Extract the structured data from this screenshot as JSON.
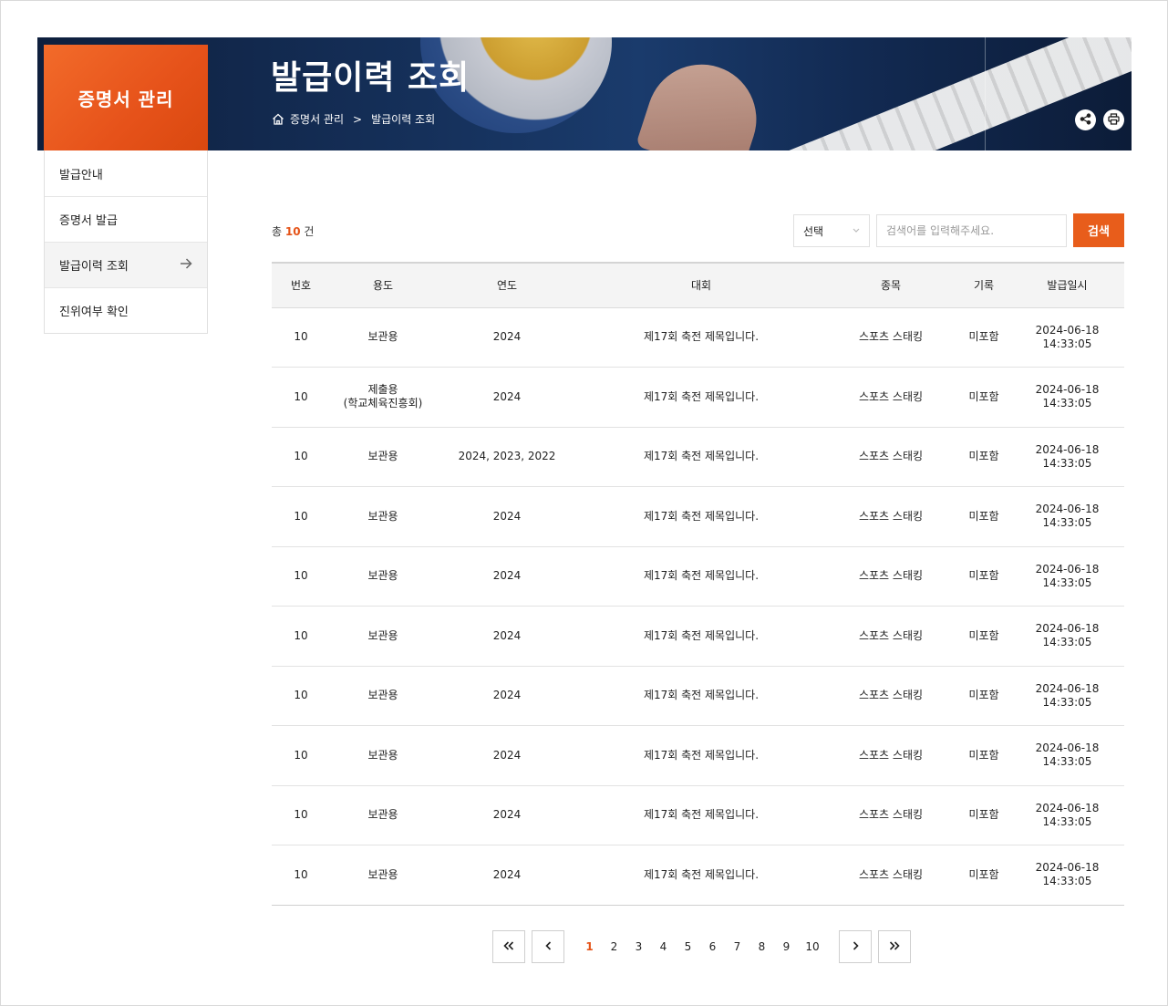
{
  "section": {
    "title": "증명서 관리"
  },
  "header": {
    "title": "발급이력 조회",
    "breadcrumb": [
      "증명서 관리",
      "발급이력 조회"
    ],
    "breadcrumb_sep": ">"
  },
  "sidebar": {
    "items": [
      {
        "label": "발급안내",
        "active": false
      },
      {
        "label": "증명서 발급",
        "active": false
      },
      {
        "label": "발급이력 조회",
        "active": true
      },
      {
        "label": "진위여부 확인",
        "active": false
      }
    ]
  },
  "toolbar": {
    "total_prefix": "총",
    "total_count": "10",
    "total_suffix": "건",
    "select_value": "선택",
    "search_placeholder": "검색어를 입력해주세요.",
    "search_label": "검색"
  },
  "table": {
    "columns": [
      "번호",
      "용도",
      "연도",
      "대회",
      "종목",
      "기록",
      "발급일시"
    ],
    "rows": [
      {
        "no": "10",
        "usage": "보관용",
        "usage2": "",
        "year": "2024",
        "event": "제17회 축전 제목입니다.",
        "sport": "스포츠 스태킹",
        "record": "미포함",
        "date": "2024-06-18",
        "time": "14:33:05"
      },
      {
        "no": "10",
        "usage": "제출용",
        "usage2": "(학교체육진흥회)",
        "year": "2024",
        "event": "제17회 축전 제목입니다.",
        "sport": "스포츠 스태킹",
        "record": "미포함",
        "date": "2024-06-18",
        "time": "14:33:05"
      },
      {
        "no": "10",
        "usage": "보관용",
        "usage2": "",
        "year": "2024, 2023, 2022",
        "event": "제17회 축전 제목입니다.",
        "sport": "스포츠 스태킹",
        "record": "미포함",
        "date": "2024-06-18",
        "time": "14:33:05"
      },
      {
        "no": "10",
        "usage": "보관용",
        "usage2": "",
        "year": "2024",
        "event": "제17회 축전 제목입니다.",
        "sport": "스포츠 스태킹",
        "record": "미포함",
        "date": "2024-06-18",
        "time": "14:33:05"
      },
      {
        "no": "10",
        "usage": "보관용",
        "usage2": "",
        "year": "2024",
        "event": "제17회 축전 제목입니다.",
        "sport": "스포츠 스태킹",
        "record": "미포함",
        "date": "2024-06-18",
        "time": "14:33:05"
      },
      {
        "no": "10",
        "usage": "보관용",
        "usage2": "",
        "year": "2024",
        "event": "제17회 축전 제목입니다.",
        "sport": "스포츠 스태킹",
        "record": "미포함",
        "date": "2024-06-18",
        "time": "14:33:05"
      },
      {
        "no": "10",
        "usage": "보관용",
        "usage2": "",
        "year": "2024",
        "event": "제17회 축전 제목입니다.",
        "sport": "스포츠 스태킹",
        "record": "미포함",
        "date": "2024-06-18",
        "time": "14:33:05"
      },
      {
        "no": "10",
        "usage": "보관용",
        "usage2": "",
        "year": "2024",
        "event": "제17회 축전 제목입니다.",
        "sport": "스포츠 스태킹",
        "record": "미포함",
        "date": "2024-06-18",
        "time": "14:33:05"
      },
      {
        "no": "10",
        "usage": "보관용",
        "usage2": "",
        "year": "2024",
        "event": "제17회 축전 제목입니다.",
        "sport": "스포츠 스태킹",
        "record": "미포함",
        "date": "2024-06-18",
        "time": "14:33:05"
      },
      {
        "no": "10",
        "usage": "보관용",
        "usage2": "",
        "year": "2024",
        "event": "제17회 축전 제목입니다.",
        "sport": "스포츠 스태킹",
        "record": "미포함",
        "date": "2024-06-18",
        "time": "14:33:05"
      }
    ]
  },
  "pagination": {
    "first_icon": "double-chevron-left-icon",
    "prev_icon": "chevron-left-icon",
    "next_icon": "chevron-right-icon",
    "last_icon": "double-chevron-right-icon",
    "pages": [
      "1",
      "2",
      "3",
      "4",
      "5",
      "6",
      "7",
      "8",
      "9",
      "10"
    ],
    "current": "1"
  },
  "icons": {
    "home": "home-icon",
    "share": "share-icon",
    "print": "print-icon",
    "active_arrow": "arrow-right-icon",
    "select_chevron": "chevron-down-icon"
  },
  "colors": {
    "accent": "#e85d1b",
    "section_box": "#e6521a",
    "header_bg": "#15305a"
  }
}
